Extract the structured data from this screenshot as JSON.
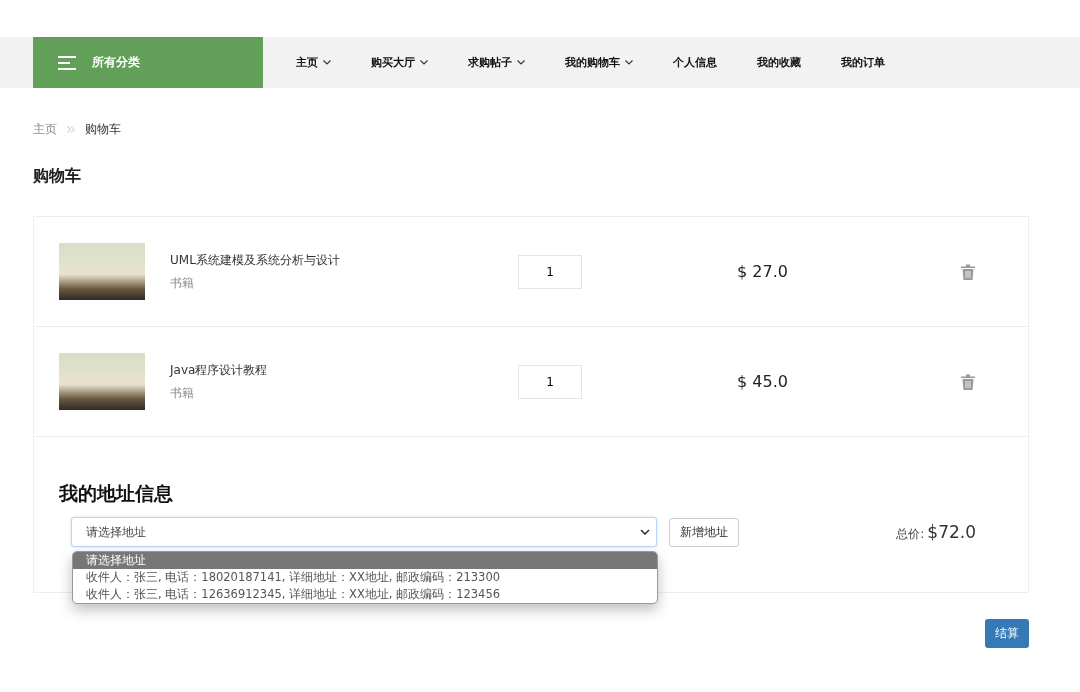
{
  "nav": {
    "category_label": "所有分类",
    "items": [
      {
        "label": "主页",
        "has_menu": true
      },
      {
        "label": "购买大厅",
        "has_menu": true
      },
      {
        "label": "求购帖子",
        "has_menu": true
      },
      {
        "label": "我的购物车",
        "has_menu": true
      },
      {
        "label": "个人信息",
        "has_menu": false
      },
      {
        "label": "我的收藏",
        "has_menu": false
      },
      {
        "label": "我的订单",
        "has_menu": false
      }
    ]
  },
  "breadcrumb": [
    "主页",
    "购物车"
  ],
  "page_title": "购物车",
  "cart_items": [
    {
      "name": "UML系统建模及系统分析与设计",
      "category": "书籍",
      "quantity": "1",
      "price": "$ 27.0"
    },
    {
      "name": "Java程序设计教程",
      "category": "书籍",
      "quantity": "1",
      "price": "$ 45.0"
    }
  ],
  "address": {
    "heading": "我的地址信息",
    "select_value": "请选择地址",
    "add_button": "新增地址",
    "expanded": true,
    "options": [
      {
        "label": "请选择地址",
        "selected": true
      },
      {
        "label": "收件人：张三, 电话：18020187141, 详细地址：XX地址, 邮政编码：213300",
        "selected": false
      },
      {
        "label": "收件人：张三, 电话：12636912345, 详细地址：XX地址, 邮政编码：123456",
        "selected": false
      }
    ]
  },
  "total": {
    "label": "总价:",
    "value": "$72.0"
  },
  "checkout_button": "结算"
}
